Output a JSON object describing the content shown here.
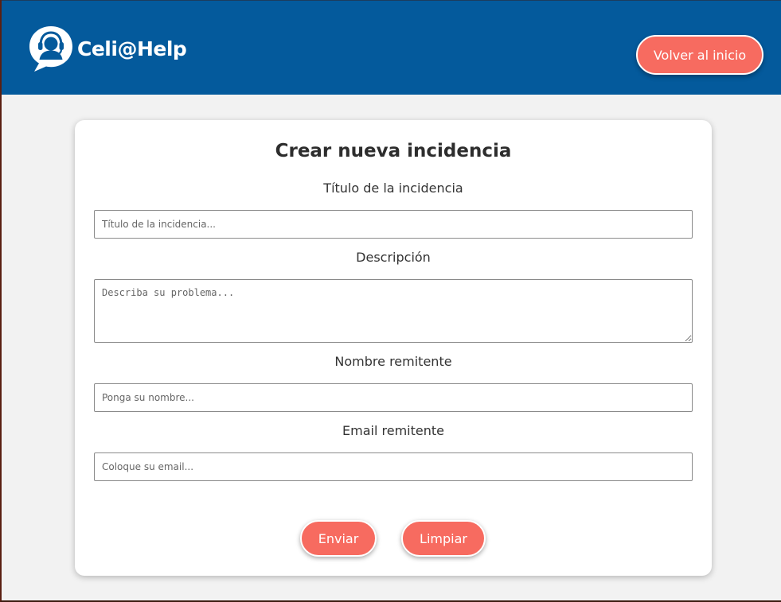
{
  "header": {
    "logo_text": "Celi@Help",
    "logo_icon": "headset-chat-icon",
    "home_button_label": "Volver al inicio",
    "background_color": "#045a9c"
  },
  "form": {
    "title": "Crear nueva incidencia",
    "fields": [
      {
        "label": "Título de la incidencia",
        "placeholder": "Título de la incidencia...",
        "value": ""
      },
      {
        "label": "Descripción",
        "placeholder": "Describa su problema...",
        "value": ""
      },
      {
        "label": "Nombre remitente",
        "placeholder": "Ponga su nombre...",
        "value": ""
      },
      {
        "label": "Email remitente",
        "placeholder": "Coloque su email...",
        "value": ""
      }
    ],
    "submit_label": "Enviar",
    "reset_label": "Limpiar",
    "accent_color": "#f76b60"
  }
}
